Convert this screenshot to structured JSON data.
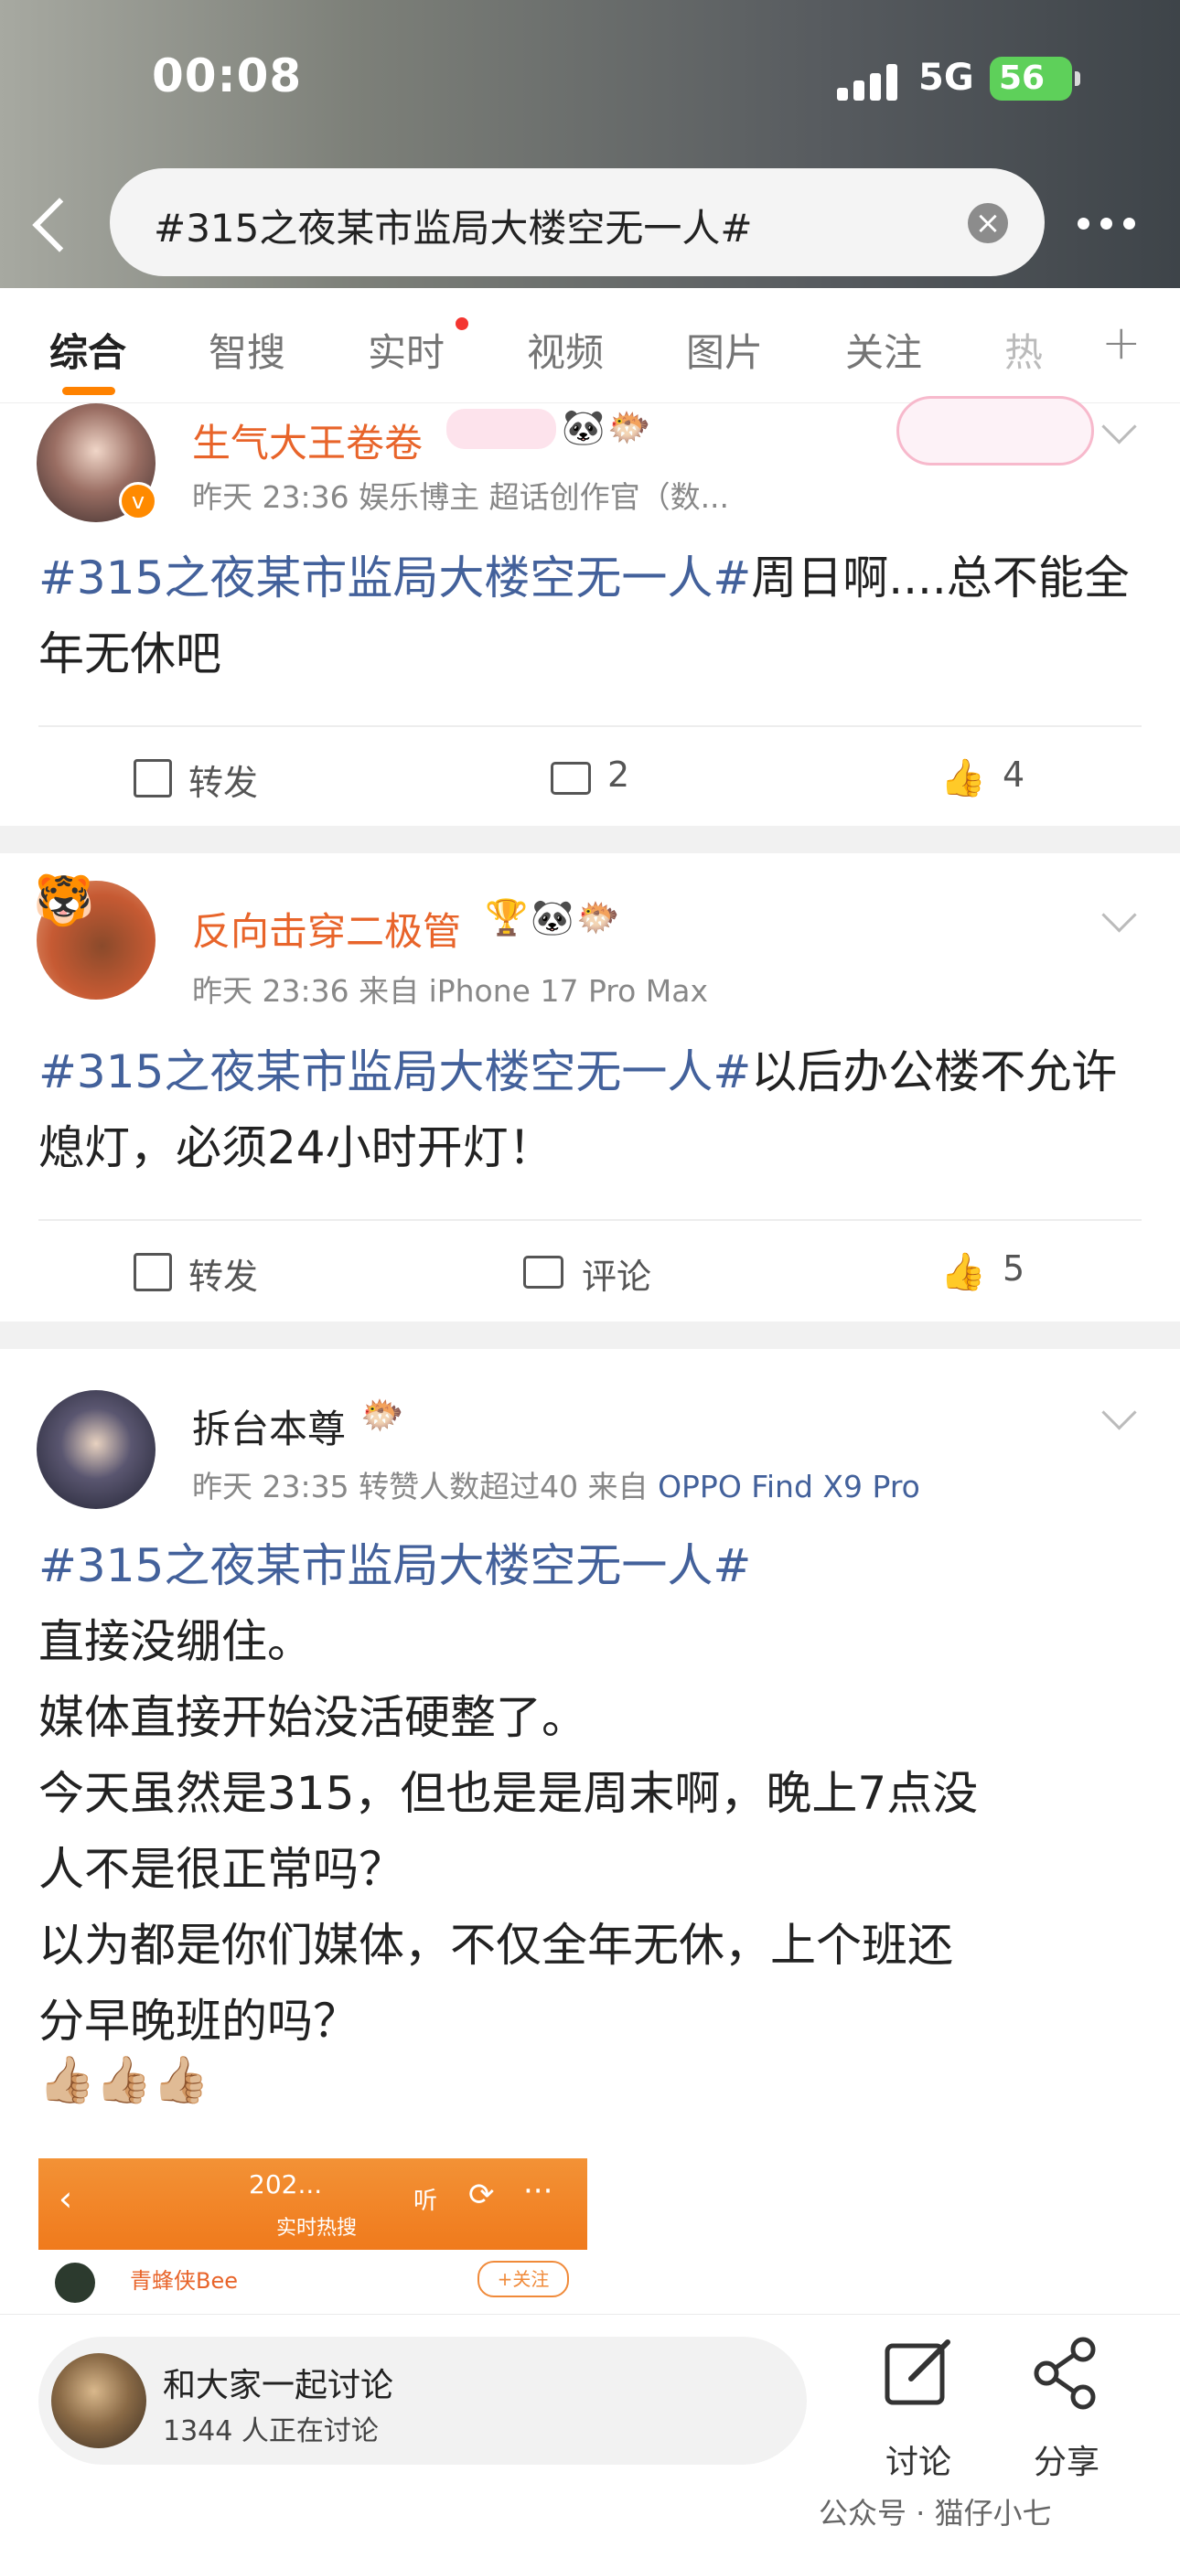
{
  "status_bar": {
    "time": "00:08",
    "network": "5G",
    "battery": "56"
  },
  "search": {
    "query": "#315之夜某市监局大楼空无一人#"
  },
  "tabs": [
    {
      "label": "综合"
    },
    {
      "label": "智搜"
    },
    {
      "label": "实时"
    },
    {
      "label": "视频"
    },
    {
      "label": "图片"
    },
    {
      "label": "关注"
    },
    {
      "label": "热"
    }
  ],
  "posts": [
    {
      "user": "生气大王卷卷",
      "meta": "昨天 23:36  娱乐博主 超话创作官（数...",
      "topic": "#315之夜某市监局大楼空无一人#",
      "text": "周日啊....总不能全年无休吧",
      "repost": "转发",
      "comments": "2",
      "likes": "4"
    },
    {
      "user": "反向击穿二极管",
      "meta_prefix": "昨天 23:36  来自 ",
      "device": "iPhone 17 Pro Max",
      "topic": "#315之夜某市监局大楼空无一人#",
      "text": "以后办公楼不允许熄灯，必须24小时开灯！",
      "repost": "转发",
      "comments": "评论",
      "likes": "5"
    },
    {
      "user": "拆台本尊",
      "meta_prefix": "昨天 23:35  转赞人数超过40  来自 ",
      "device": "OPPO Find X9 Pro",
      "topic": "#315之夜某市监局大楼空无一人#",
      "lines": [
        "直接没绷住。",
        "媒体直接开始没活硬整了。",
        "今天虽然是315，但也是是周末啊，晚上7点没",
        "人不是很正常吗？",
        "以为都是你们媒体，不仅全年无休，上个班还",
        "分早晚班的吗？"
      ],
      "emoji": "👍🏼👍🏼👍🏼",
      "embed": {
        "title": "202...",
        "subtitle": "实时热搜",
        "user": "青蜂侠Bee",
        "follow": "+关注",
        "listen": "听"
      }
    }
  ],
  "bottom": {
    "discuss_title": "和大家一起讨论",
    "discuss_count": "1344 人正在讨论",
    "comment_label": "讨论",
    "share_label": "分享",
    "watermark": "公众号 · 猫仔小七"
  }
}
